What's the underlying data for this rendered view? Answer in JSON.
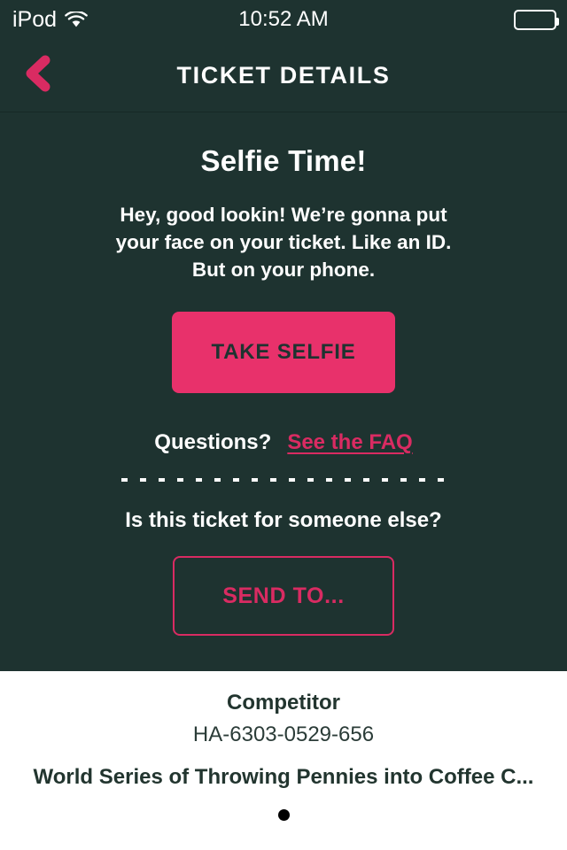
{
  "status_bar": {
    "carrier": "iPod",
    "wifi_icon": "wifi-icon",
    "time": "10:52 AM",
    "battery_icon": "battery-full-icon"
  },
  "navbar": {
    "back_icon": "chevron-left-icon",
    "title": "TICKET DETAILS"
  },
  "main": {
    "headline": "Selfie Time!",
    "blurb": "Hey, good lookin! We’re gonna put your face on your ticket. Like an ID. But on your phone.",
    "take_selfie_label": "TAKE SELFIE",
    "questions_label": "Questions?",
    "faq_link_label": "See the FAQ",
    "transfer_prompt": "Is this ticket for someone else?",
    "send_to_label": "SEND TO..."
  },
  "footer": {
    "role": "Competitor",
    "ticket_code": "HA-6303-0529-656",
    "event_title": "World Series of Throwing Pennies into Coffee C...",
    "page_count": 1,
    "active_page": 1
  },
  "colors": {
    "background": "#1e3330",
    "accent_pink": "#e8316b",
    "link_pink": "#d92b62",
    "text_light": "#ffffff",
    "footer_background": "#ffffff",
    "footer_text": "#22352f"
  }
}
